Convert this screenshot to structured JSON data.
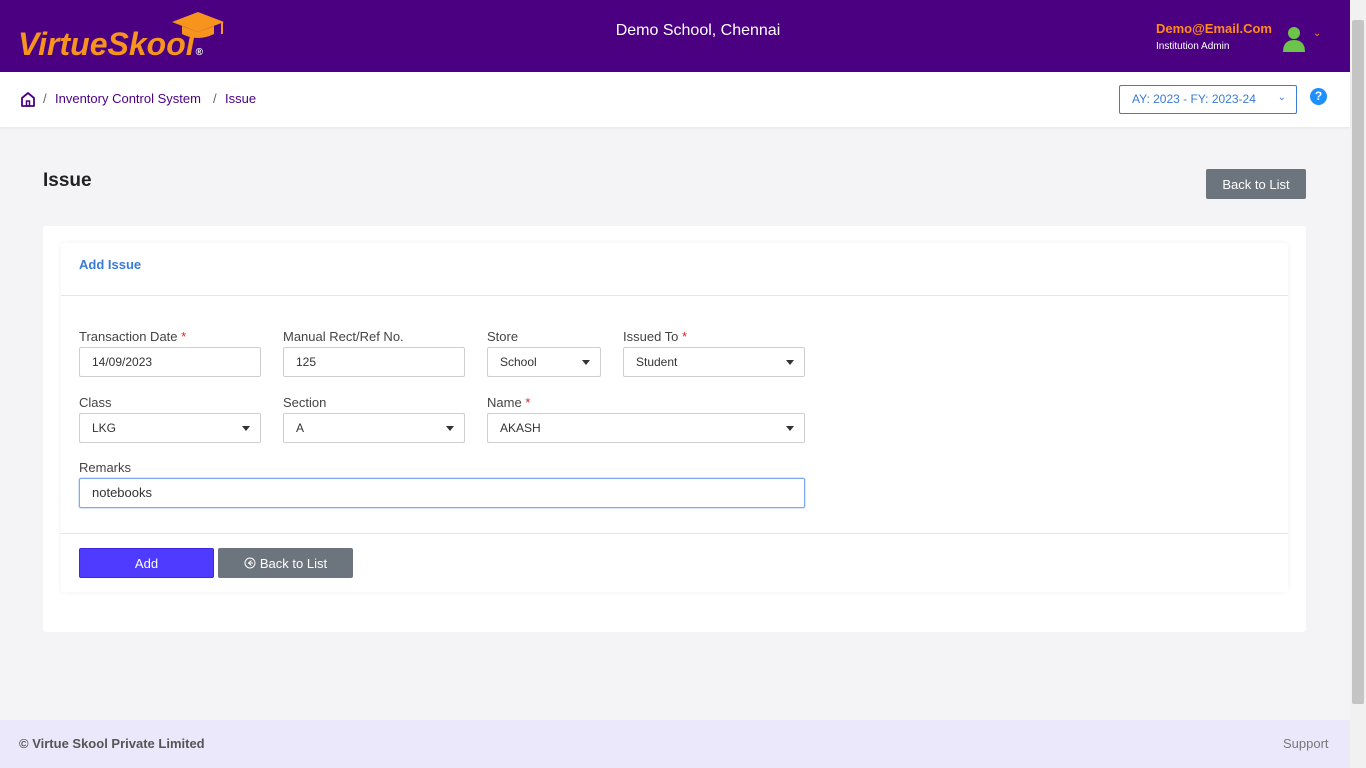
{
  "header": {
    "logo_text": "VirtueSkool",
    "logo_reg": "®",
    "school_name": "Demo School, Chennai",
    "user_email": "Demo@Email.Com",
    "user_role": "Institution Admin"
  },
  "breadcrumb": {
    "items": [
      "Inventory Control System",
      "Issue"
    ],
    "separator": "/"
  },
  "academic_year": "AY: 2023 - FY: 2023-24",
  "help_label": "?",
  "page": {
    "title": "Issue",
    "back_to_list": "Back to List"
  },
  "form": {
    "card_title": "Add Issue",
    "required_mark": "*",
    "fields": {
      "transaction_date": {
        "label": "Transaction Date",
        "value": "14/09/2023"
      },
      "manual_ref": {
        "label": "Manual Rect/Ref No.",
        "value": "125"
      },
      "store": {
        "label": "Store",
        "value": "School"
      },
      "issued_to": {
        "label": "Issued To",
        "value": "Student"
      },
      "class": {
        "label": "Class",
        "value": "LKG"
      },
      "section": {
        "label": "Section",
        "value": "A"
      },
      "name": {
        "label": "Name",
        "value": "AKASH"
      },
      "remarks": {
        "label": "Remarks",
        "value": "notebooks"
      }
    },
    "add_button": "Add",
    "back_button": "Back to List"
  },
  "footer": {
    "copyright": "© Virtue Skool Private Limited",
    "support": "Support"
  },
  "colors": {
    "header_bg": "#4b0082",
    "brand_orange": "#f7941d",
    "accent_blue": "#3a7bd5",
    "primary_button": "#4f3bff",
    "secondary_button": "#6c757d",
    "footer_bg": "#ece8fb"
  },
  "icons": [
    "graduation-cap-icon",
    "user-avatar-icon",
    "chevron-down-icon",
    "home-icon",
    "help-icon",
    "back-arrow-icon"
  ]
}
